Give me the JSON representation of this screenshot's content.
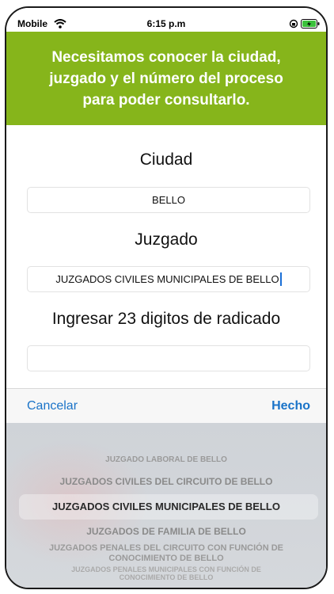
{
  "status_bar": {
    "carrier": "Mobile",
    "time": "6:15 p.m"
  },
  "header": {
    "message": "Necesitamos conocer la ciudad, juzgado y el número del proceso para poder consultarlo."
  },
  "form": {
    "city_label": "Ciudad",
    "city_value": "BELLO",
    "court_label": "Juzgado",
    "court_value": "JUZGADOS CIVILES MUNICIPALES DE BELLO",
    "case_label": "Ingresar 23 digitos de radicado",
    "case_value": ""
  },
  "toolbar": {
    "cancel_label": "Cancelar",
    "done_label": "Hecho"
  },
  "picker": {
    "selected_index": 2,
    "items": [
      "JUZGADO LABORAL DE BELLO",
      "JUZGADOS CIVILES DEL CIRCUITO DE BELLO",
      "JUZGADOS CIVILES MUNICIPALES DE BELLO",
      "JUZGADOS DE FAMILIA DE BELLO",
      "JUZGADOS PENALES DEL CIRCUITO CON FUNCIÓN DE CONOCIMIENTO DE BELLO",
      "JUZGADOS PENALES MUNICIPALES CON FUNCIÓN DE CONOCIMIENTO DE BELLO"
    ]
  },
  "colors": {
    "header_bg": "#86b51b",
    "accent": "#1a73c8"
  },
  "icons": [
    "wifi-icon",
    "orientation-lock-icon",
    "battery-icon"
  ]
}
